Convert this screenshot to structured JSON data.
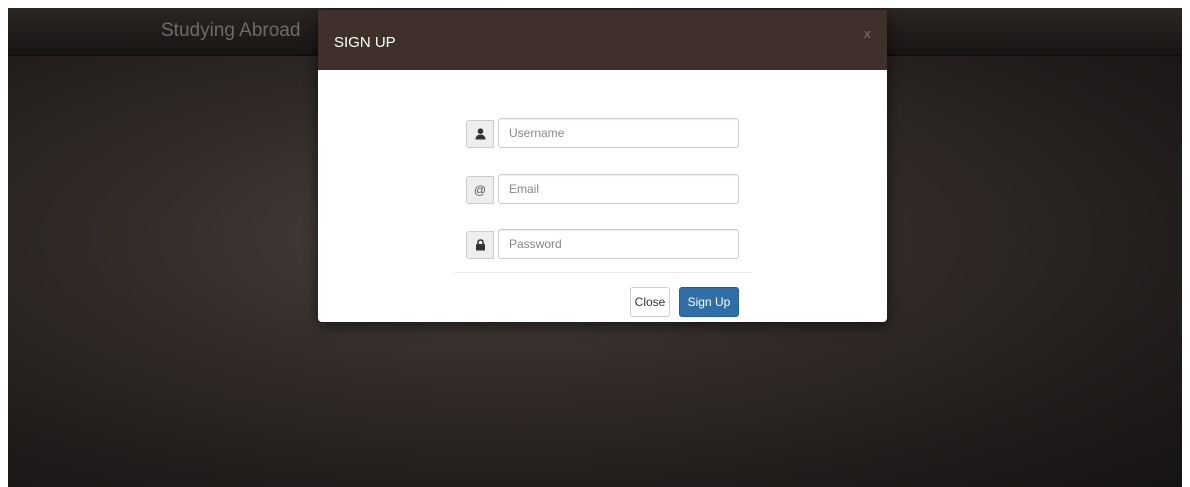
{
  "navbar": {
    "brand": "Studying Abroad"
  },
  "modal": {
    "title": "SIGN UP",
    "close_glyph": "x",
    "fields": {
      "username": {
        "icon": "user-icon",
        "placeholder": "Username",
        "value": ""
      },
      "email": {
        "icon": "at-icon",
        "addon_text": "@",
        "placeholder": "Email",
        "value": ""
      },
      "password": {
        "icon": "lock-icon",
        "placeholder": "Password",
        "value": ""
      }
    },
    "buttons": {
      "close_label": "Close",
      "signup_label": "Sign Up"
    }
  },
  "colors": {
    "header": "#3f302b",
    "primary_button": "#2f6ea7",
    "backdrop": "#2a2422"
  }
}
